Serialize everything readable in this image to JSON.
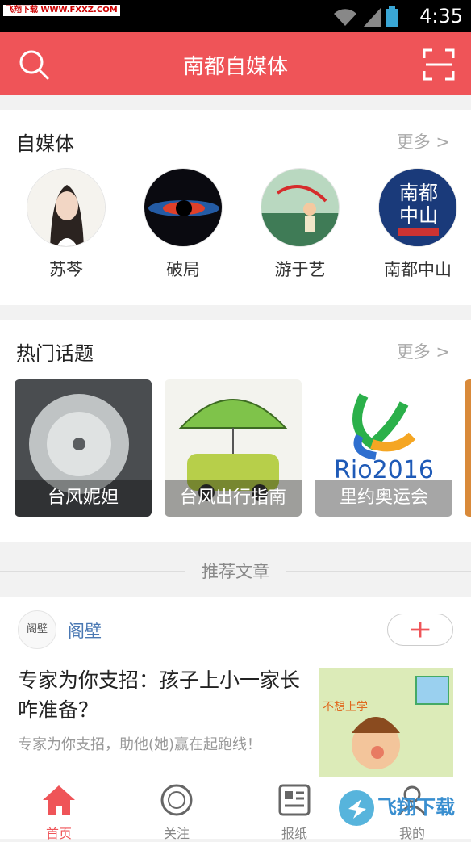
{
  "statusbar": {
    "watermark": "飞翔下载 WWW.FXXZ.COM",
    "time": "4:35"
  },
  "header": {
    "title": "南都自媒体"
  },
  "selfmedia": {
    "title": "自媒体",
    "more": "更多 >",
    "items": [
      {
        "label": "苏芩"
      },
      {
        "label": "破局"
      },
      {
        "label": "游于艺"
      },
      {
        "label": "南都中山",
        "logo_text": "南都\n中山"
      }
    ]
  },
  "hot": {
    "title": "热门话题",
    "more": "更多 >",
    "items": [
      {
        "label": "台风妮妲"
      },
      {
        "label": "台风出行指南"
      },
      {
        "label": "里约奥运会"
      }
    ]
  },
  "recommend": {
    "title": "推荐文章"
  },
  "article": {
    "author_logo": "阁壁",
    "author": "阁壁",
    "title": "专家为你支招：孩子上小一家长咋准备？",
    "summary": "专家为你支招，助他(她)赢在起跑线！",
    "thumb_text": "不想上学"
  },
  "tabbar": {
    "items": [
      {
        "label": "首页",
        "icon": "home-icon",
        "active": true
      },
      {
        "label": "关注",
        "icon": "follow-icon",
        "active": false
      },
      {
        "label": "报纸",
        "icon": "newspaper-icon",
        "active": false
      },
      {
        "label": "我的",
        "icon": "profile-icon",
        "active": false
      }
    ]
  },
  "brand_watermark": "飞翔下载",
  "colors": {
    "accent": "#ef5458",
    "link": "#4a78b3"
  }
}
